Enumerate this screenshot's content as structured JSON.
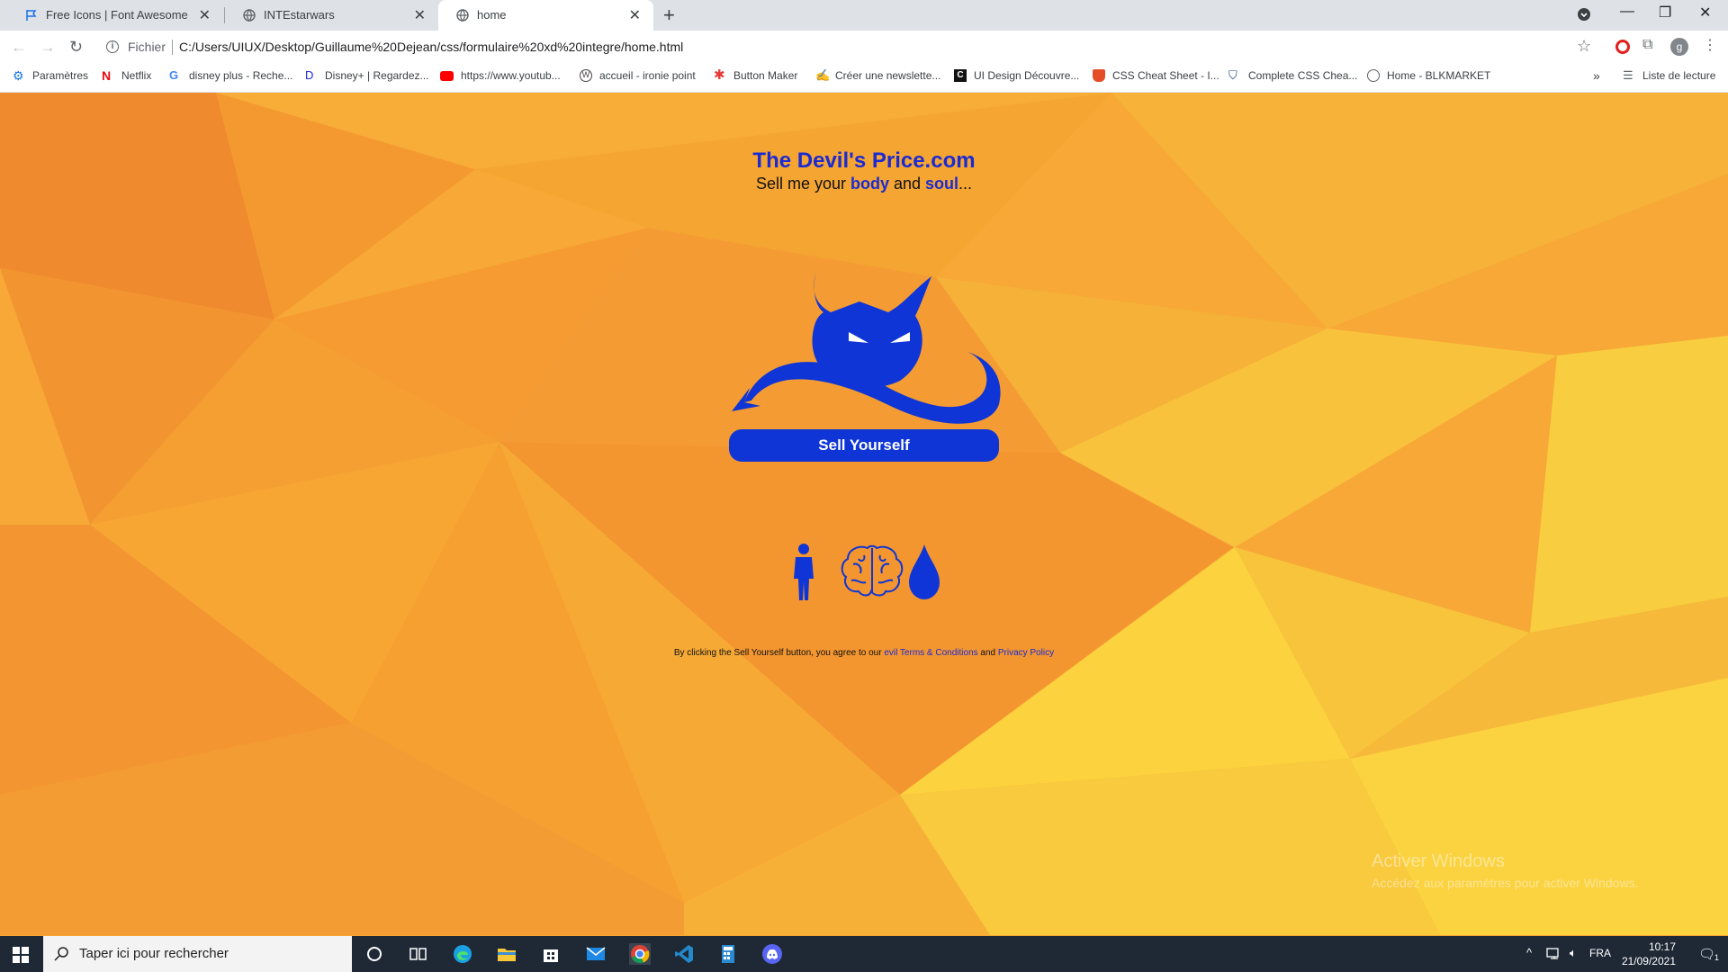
{
  "browser": {
    "tabs": [
      {
        "label": "Free Icons | Font Awesome",
        "active": false
      },
      {
        "label": "INTEstarwars",
        "active": false
      },
      {
        "label": "home",
        "active": true
      }
    ],
    "scheme_label": "Fichier",
    "url": "C:/Users/UIUX/Desktop/Guillaume%20Dejean/css/formulaire%20xd%20integre/home.html",
    "profile_initial": "g",
    "bookmarks": [
      {
        "label": "Paramètres",
        "icon": "gear-icon"
      },
      {
        "label": "Netflix",
        "icon": "netflix-icon"
      },
      {
        "label": "disney plus - Reche...",
        "icon": "google-icon"
      },
      {
        "label": "Disney+ | Regardez...",
        "icon": "disney-icon"
      },
      {
        "label": "https://www.youtub...",
        "icon": "youtube-icon"
      },
      {
        "label": "accueil - ironie point",
        "icon": "wordpress-icon"
      },
      {
        "label": "Button Maker",
        "icon": "star-burst-icon"
      },
      {
        "label": "Créer une newslette...",
        "icon": "signature-icon"
      },
      {
        "label": "UI Design Découvre...",
        "icon": "c-icon"
      },
      {
        "label": "CSS Cheat Sheet - I...",
        "icon": "html5-icon"
      },
      {
        "label": "Complete CSS Chea...",
        "icon": "shield-icon"
      },
      {
        "label": "Home - BLKMARKET",
        "icon": "globe-icon"
      }
    ],
    "reading_list": "Liste de lecture"
  },
  "page": {
    "title": "The Devil's Price.com",
    "tagline_prefix": "Sell me your ",
    "tagline_body": "body",
    "tagline_and": " and ",
    "tagline_soul": "soul",
    "tagline_suffix": "...",
    "sell_button": "Sell Yourself",
    "terms_prefix": "By clicking the Sell Yourself button, you agree to our ",
    "terms_link1": "evil Terms & Conditions",
    "terms_and": " and ",
    "terms_link2": "Privacy Policy",
    "colors": {
      "accent": "#1b2bd1",
      "button": "#0f35d6",
      "background": "#f6a630"
    }
  },
  "watermark": {
    "line1": "Activer Windows",
    "line2": "Accédez aux paramètres pour activer Windows."
  },
  "taskbar": {
    "search_placeholder": "Taper ici pour rechercher",
    "language": "FRA",
    "time": "10:17",
    "date": "21/09/2021",
    "notification_count": "1"
  }
}
